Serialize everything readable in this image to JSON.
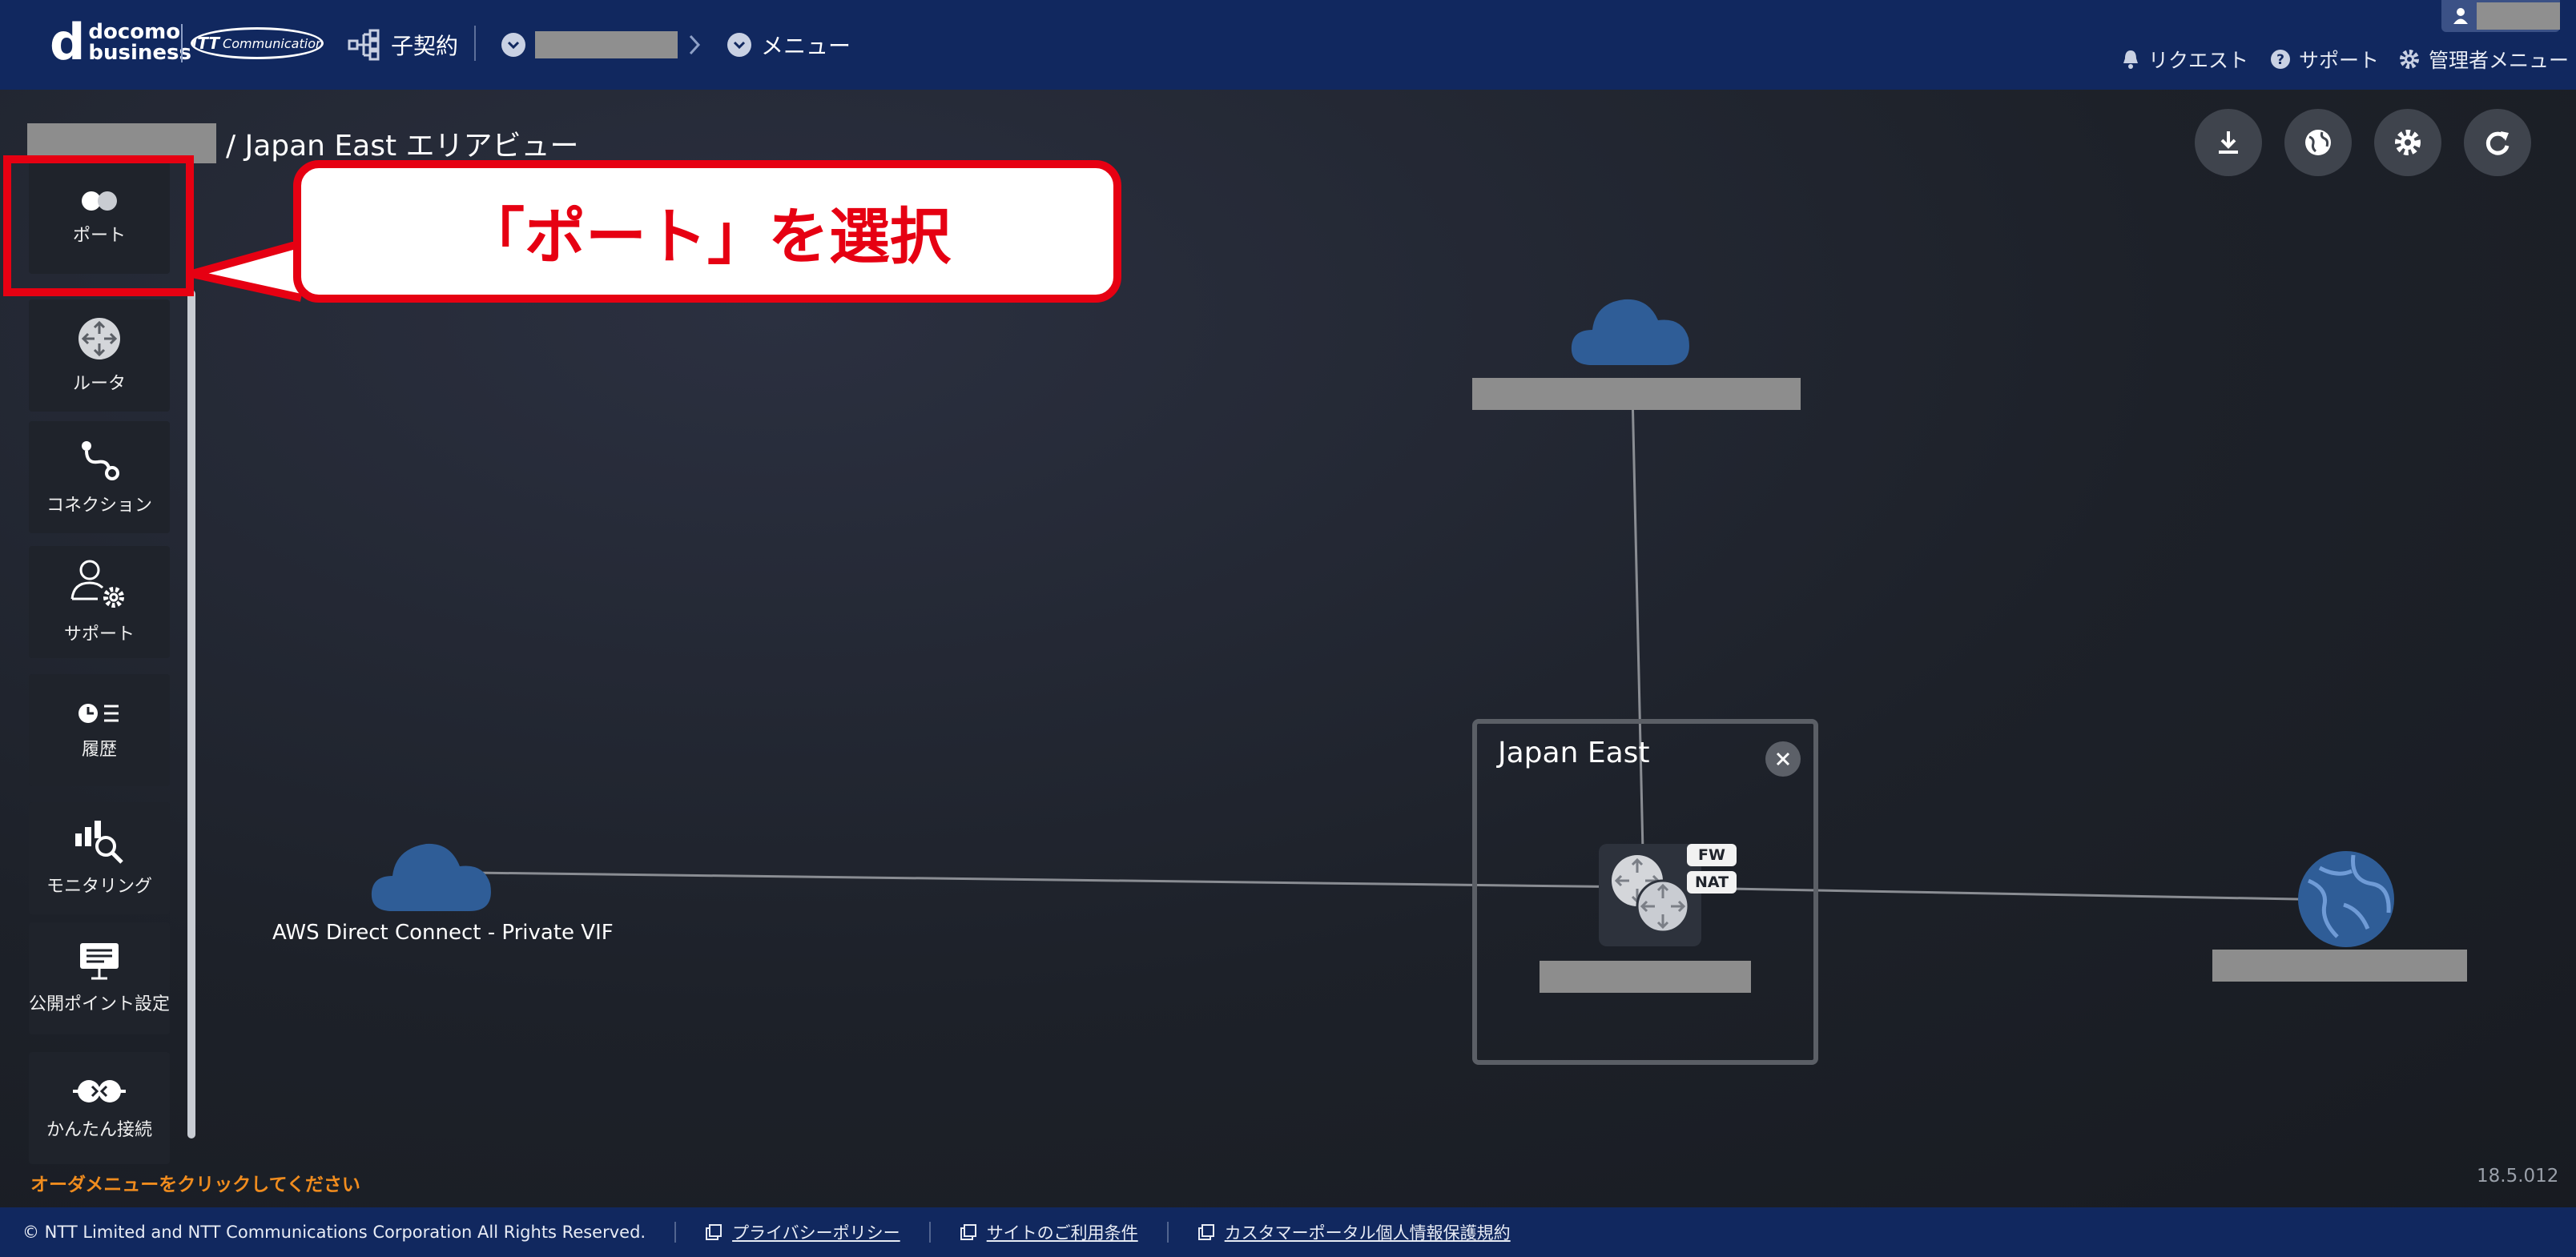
{
  "header": {
    "logo_main": "d",
    "logo_line1": "docomo",
    "logo_line2": "business",
    "ntt_logo_text": "NTT",
    "ntt_logo_sub": "Communications",
    "contract_label": "子契約",
    "menu_label": "メニュー",
    "request_label": "リクエスト",
    "support_label": "サポート",
    "admin_label": "管理者メニュー"
  },
  "breadcrumb": {
    "area_label": "/ Japan East エリアビュー"
  },
  "toolbar": {
    "download_icon": "download-icon",
    "globe_icon": "globe-icon",
    "settings_icon": "gear-icon",
    "refresh_icon": "refresh-icon"
  },
  "sidebar": {
    "items": [
      {
        "label": "ポート",
        "icon": "port-icon"
      },
      {
        "label": "ルータ",
        "icon": "router-icon"
      },
      {
        "label": "コネクション",
        "icon": "connection-icon"
      },
      {
        "label": "サポート",
        "icon": "support-user-icon"
      },
      {
        "label": "履歴",
        "icon": "history-icon"
      },
      {
        "label": "モニタリング",
        "icon": "monitoring-icon"
      },
      {
        "label": "公開ポイント設定",
        "icon": "public-point-icon"
      },
      {
        "label": "かんたん接続",
        "icon": "easy-connect-icon"
      }
    ]
  },
  "annotation": {
    "callout_text": "「ポート」を選択",
    "color": "#e60012"
  },
  "diagram": {
    "aws_label": "AWS Direct Connect - Private VIF",
    "region_title": "Japan East",
    "fw_badge": "FW",
    "nat_badge": "NAT"
  },
  "order_hint": "オーダメニューをクリックしてください",
  "version": "18.5.012",
  "footer": {
    "copyright": "© NTT Limited and NTT Communications Corporation All Rights Reserved.",
    "privacy_link": "プライバシーポリシー",
    "terms_link": "サイトのご利用条件",
    "customer_privacy_link": "カスタマーポータル個人情報保護規約"
  },
  "colors": {
    "header_bg": "#11285f",
    "cloud": "#2f5d97",
    "hint": "#f08c1e"
  }
}
